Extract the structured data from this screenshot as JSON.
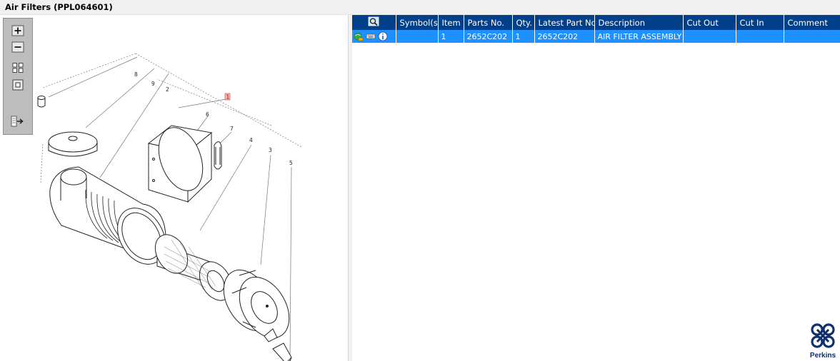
{
  "window": {
    "title": "Air Filters (PPL064601)"
  },
  "toolbox": {
    "tools": [
      {
        "name": "zoom-in",
        "icon": "zoom-in-icon"
      },
      {
        "name": "zoom-out",
        "icon": "zoom-out-icon"
      },
      {
        "name": "fit-all",
        "icon": "fit-all-icon"
      },
      {
        "name": "fit-window",
        "icon": "fit-window-icon"
      },
      {
        "name": "export",
        "icon": "export-icon"
      }
    ]
  },
  "drawing": {
    "callouts": [
      "8",
      "9",
      "2",
      "1",
      "6",
      "7",
      "4",
      "3",
      "5"
    ],
    "highlighted_callout": "1"
  },
  "parts_table": {
    "columns": [
      "Symbol(s)",
      "Item",
      "Parts No.",
      "Qty.",
      "Latest Part No.",
      "Description",
      "Cut Out",
      "Cut In",
      "Comment"
    ],
    "header_icon": "search-parts-icon",
    "rows": [
      {
        "symbols": "",
        "item": "1",
        "parts_no": "2652C202",
        "qty": "1",
        "latest_part_no": "2652C202",
        "description": "AIR FILTER ASSEMBLY",
        "cut_out": "",
        "cut_in": "",
        "comment": ""
      }
    ],
    "row_icons": [
      "globe-cart-icon",
      "keyboard-icon",
      "info-icon"
    ],
    "selected_row_color": "#1e90ff",
    "header_color": "#003f8a"
  },
  "brand": {
    "name": "Perkins",
    "color": "#0e2e6e"
  }
}
